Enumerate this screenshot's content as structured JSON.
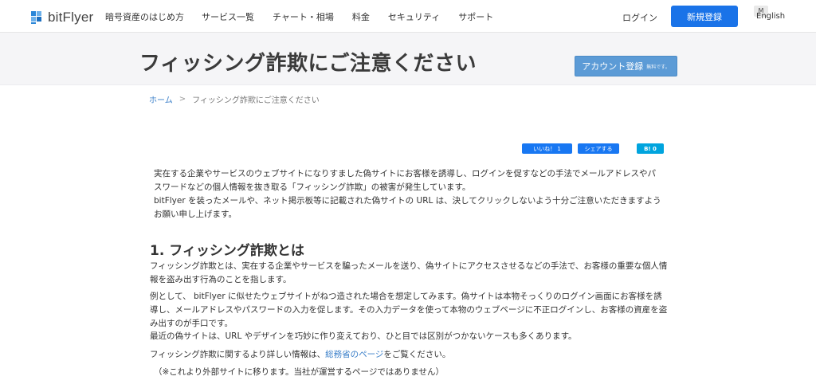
{
  "header": {
    "brand": "bitFlyer",
    "nav": [
      "暗号資産のはじめ方",
      "サービス一覧",
      "チャート・相場",
      "料金",
      "セキュリティ",
      "サポート"
    ],
    "login": "ログイン",
    "signup": "新規登録",
    "lang_badge": "M",
    "lang": "English"
  },
  "band": {
    "title": "フィッシング詐欺にご注意ください",
    "account_button": "アカウント登録",
    "account_button_sub": "無料です。"
  },
  "breadcrumb": {
    "home": "ホーム",
    "separator": ">",
    "current": "フィッシング詐欺にご注意ください"
  },
  "share": {
    "like": "いいね！ 1",
    "share": "シェアする",
    "hatena": "B! 0"
  },
  "intro": {
    "p1": "実在する企業やサービスのウェブサイトになりすました偽サイトにお客様を誘導し、ログインを促すなどの手法でメールアドレスやパスワードなどの個人情報を抜き取る「フィッシング詐欺」の被害が発生しています。",
    "p2": "bitFlyer を装ったメールや、ネット掲示板等に記載された偽サイトの URL は、決してクリックしないよう十分ご注意いただきますようお願い申し上げます。"
  },
  "section1": {
    "heading": "1. フィッシング詐欺とは",
    "p1": "フィッシング詐欺とは、実在する企業やサービスを騙ったメールを送り、偽サイトにアクセスさせるなどの手法で、お客様の重要な個人情報を盗み出す行為のことを指します。",
    "p2": "例として、 bitFlyer に似せたウェブサイトがねつ造された場合を想定してみます。偽サイトは本物そっくりのログイン画面にお客様を誘導し、メールアドレスやパスワードの入力を促します。その入力データを使って本物のウェブページに不正ログインし、お客様の資産を盗み出すのが手口です。",
    "p3": "最近の偽サイトは、URL やデザインを巧妙に作り変えており、ひと目では区別がつかないケースも多くあります。",
    "p4_before": "フィッシング詐欺に関するより詳しい情報は、",
    "p4_link": "総務省のページ",
    "p4_after": "をご覧ください。",
    "p5": "（※これより外部サイトに移ります。当社が運営するページではありません）"
  }
}
